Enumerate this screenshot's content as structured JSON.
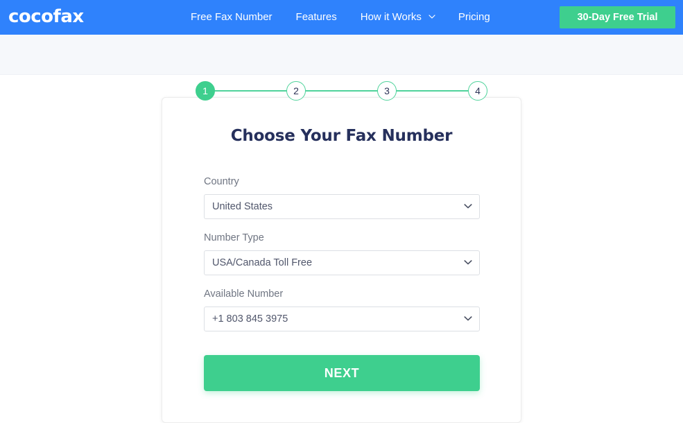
{
  "brand": {
    "logo_text": "cocofax",
    "header_bg": "#2f82fc",
    "accent_green": "#3ecf8e",
    "title_color": "#26305c"
  },
  "nav": {
    "items": [
      {
        "label": "Free Fax Number",
        "has_caret": false
      },
      {
        "label": "Features",
        "has_caret": false
      },
      {
        "label": "How it Works",
        "has_caret": true
      },
      {
        "label": "Pricing",
        "has_caret": false
      }
    ],
    "cta_label": "30-Day Free Trial"
  },
  "stepper": {
    "steps": [
      {
        "number": "1",
        "state": "active"
      },
      {
        "number": "2",
        "state": "inactive"
      },
      {
        "number": "3",
        "state": "inactive"
      },
      {
        "number": "4",
        "state": "inactive"
      }
    ]
  },
  "card": {
    "title": "Choose Your Fax Number",
    "fields": [
      {
        "label": "Country",
        "value": "United States",
        "name": "country"
      },
      {
        "label": "Number Type",
        "value": "USA/Canada Toll Free",
        "name": "number-type"
      },
      {
        "label": "Available Number",
        "value": "+1 803 845 3975",
        "name": "available-number"
      }
    ],
    "submit_label": "NEXT"
  }
}
